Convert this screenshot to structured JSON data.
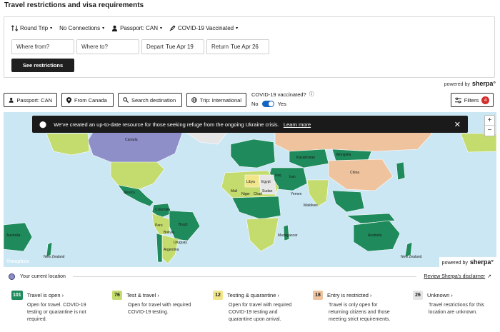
{
  "page": {
    "title": "Travel restrictions and visa requirements"
  },
  "search": {
    "trip_type": "Round Trip",
    "connections": "No Connections",
    "passport": "Passport: CAN",
    "vaccination": "COVID-19 Vaccinated",
    "from_placeholder": "Where from?",
    "to_placeholder": "Where to?",
    "depart_label": "Depart",
    "depart_value": "Tue Apr 19",
    "return_label": "Return",
    "return_value": "Tue Apr 26",
    "submit_label": "See restrictions"
  },
  "powered_by": {
    "text": "powered by",
    "brand": "sherpa°"
  },
  "controls": {
    "passport": "Passport: CAN",
    "from": "From Canada",
    "search": "Search destination",
    "trip": "Trip: International",
    "vaccinated_label": "COVID-19 vaccinated?",
    "no": "No",
    "yes": "Yes",
    "filters": "Filters",
    "filters_count": "4"
  },
  "map": {
    "banner_text": "We've created an up-to-date resource for those seeking refuge from the ongoing Ukraine crisis.",
    "banner_link": "Learn more",
    "zoom_in": "+",
    "zoom_out": "−",
    "attribution": "©mapbox",
    "labels": {
      "canada": "Canada",
      "kazakhstan": "Kazakhstan",
      "china": "China",
      "mongolia": "Mongolia",
      "iran": "Iran",
      "iraq": "Iraq",
      "libya": "Libya",
      "egypt": "Egypt",
      "sudan": "Sudan",
      "mali": "Mali",
      "niger": "Niger",
      "chad": "Chad",
      "brazil": "Brazil",
      "peru": "Peru",
      "bolivia": "Bolivia",
      "argentina": "Argentina",
      "uruguay": "Uruguay",
      "mexico": "Mexico",
      "colombia": "Colombia",
      "australia": "Australia",
      "new_zealand": "New Zealand",
      "madagascar": "Madagascar",
      "maldives": "Maldives",
      "yemen": "Yemen"
    },
    "colors": {
      "ocean": "#cbe7f4",
      "open": "#1f8a5c",
      "test": "#c4db6e",
      "quarantine": "#f2e68a",
      "restricted": "#eec39e",
      "unknown": "#e6e6e6",
      "current": "#8e8fc9"
    }
  },
  "location": {
    "label": "Your current location",
    "disclaimer": "Review Sherpa's disclaimer"
  },
  "legend": [
    {
      "count": "101",
      "title": "Travel is open ›",
      "desc": "Open for travel. COVID-19 testing or quarantine is not required.",
      "bg": "#1f8a5c",
      "fg": "#ffffff"
    },
    {
      "count": "76",
      "title": "Test & travel ›",
      "desc": "Open for travel with required COVID-19 testing.",
      "bg": "#c4db6e",
      "fg": "#1a1a1a"
    },
    {
      "count": "12",
      "title": "Testing & quarantine ›",
      "desc": "Open for travel with required COVID-19 testing and quarantine upon arrival.",
      "bg": "#f2e68a",
      "fg": "#1a1a1a"
    },
    {
      "count": "18",
      "title": "Entry is restricted ›",
      "desc": "Travel is only open for returning citizens and those meeting strict requirements.",
      "bg": "#eec39e",
      "fg": "#1a1a1a"
    },
    {
      "count": "26",
      "title": "Unknown ›",
      "desc": "Travel restrictions for this location are unknown.",
      "bg": "#e6e6e6",
      "fg": "#1a1a1a"
    }
  ]
}
